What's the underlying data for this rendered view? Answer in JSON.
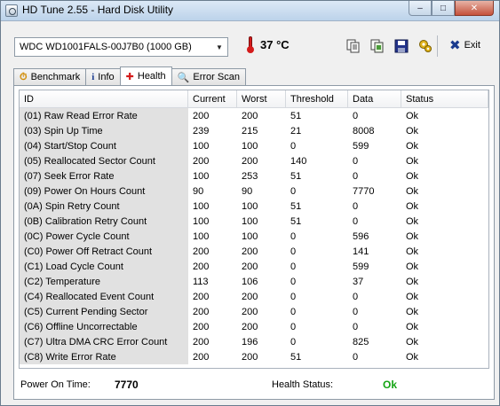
{
  "window": {
    "title": "HD Tune 2.55 - Hard Disk Utility",
    "controls": {
      "minimize": "–",
      "maximize": "□",
      "close": "✕"
    }
  },
  "toolbar": {
    "drive": "WDC WD1001FALS-00J7B0 (1000 GB)",
    "temperature": "37 °C",
    "exit_label": "Exit",
    "icons": [
      "copy-text-icon",
      "copy-screenshot-icon",
      "save-icon",
      "options-icon"
    ]
  },
  "tabs": [
    {
      "label": "Benchmark",
      "icon": "benchmark-icon",
      "active": false
    },
    {
      "label": "Info",
      "icon": "info-icon",
      "active": false
    },
    {
      "label": "Health",
      "icon": "health-cross-icon",
      "active": true
    },
    {
      "label": "Error Scan",
      "icon": "magnifier-icon",
      "active": false
    }
  ],
  "table": {
    "columns": [
      "ID",
      "Current",
      "Worst",
      "Threshold",
      "Data",
      "Status"
    ],
    "rows": [
      [
        "(01) Raw Read Error Rate",
        "200",
        "200",
        "51",
        "0",
        "Ok"
      ],
      [
        "(03) Spin Up Time",
        "239",
        "215",
        "21",
        "8008",
        "Ok"
      ],
      [
        "(04) Start/Stop Count",
        "100",
        "100",
        "0",
        "599",
        "Ok"
      ],
      [
        "(05) Reallocated Sector Count",
        "200",
        "200",
        "140",
        "0",
        "Ok"
      ],
      [
        "(07) Seek Error Rate",
        "100",
        "253",
        "51",
        "0",
        "Ok"
      ],
      [
        "(09) Power On Hours Count",
        "90",
        "90",
        "0",
        "7770",
        "Ok"
      ],
      [
        "(0A) Spin Retry Count",
        "100",
        "100",
        "51",
        "0",
        "Ok"
      ],
      [
        "(0B) Calibration Retry Count",
        "100",
        "100",
        "51",
        "0",
        "Ok"
      ],
      [
        "(0C) Power Cycle Count",
        "100",
        "100",
        "0",
        "596",
        "Ok"
      ],
      [
        "(C0) Power Off Retract Count",
        "200",
        "200",
        "0",
        "141",
        "Ok"
      ],
      [
        "(C1) Load Cycle Count",
        "200",
        "200",
        "0",
        "599",
        "Ok"
      ],
      [
        "(C2) Temperature",
        "113",
        "106",
        "0",
        "37",
        "Ok"
      ],
      [
        "(C4) Reallocated Event Count",
        "200",
        "200",
        "0",
        "0",
        "Ok"
      ],
      [
        "(C5) Current Pending Sector",
        "200",
        "200",
        "0",
        "0",
        "Ok"
      ],
      [
        "(C6) Offline Uncorrectable",
        "200",
        "200",
        "0",
        "0",
        "Ok"
      ],
      [
        "(C7) Ultra DMA CRC Error Count",
        "200",
        "196",
        "0",
        "825",
        "Ok"
      ],
      [
        "(C8) Write Error Rate",
        "200",
        "200",
        "51",
        "0",
        "Ok"
      ]
    ]
  },
  "footer": {
    "power_on_label": "Power On Time:",
    "power_on_value": "7770",
    "health_label": "Health Status:",
    "health_value": "Ok"
  },
  "colors": {
    "ok": "#14a514",
    "id_column_bg": "#e1e1e1"
  }
}
